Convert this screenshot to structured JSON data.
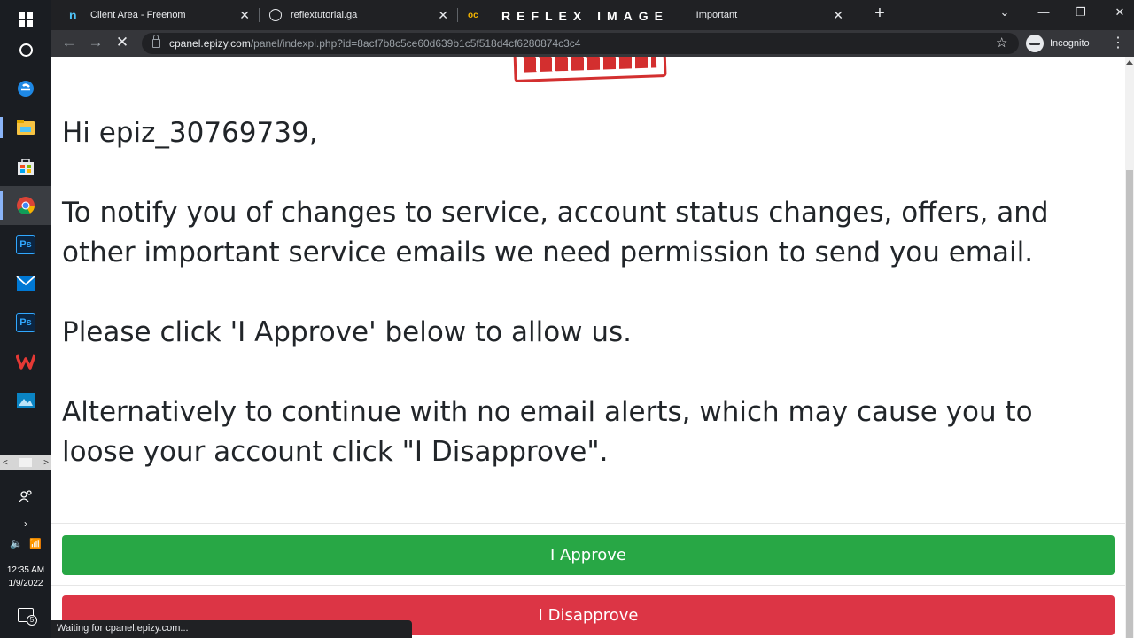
{
  "taskbar": {
    "clock_time": "12:35 AM",
    "clock_date": "1/9/2022",
    "notification_count": "5"
  },
  "tabs": [
    {
      "title": "Client Area - Freenom"
    },
    {
      "title": "reflextutorial.ga"
    },
    {
      "title": "Important"
    }
  ],
  "watermark": "REFLEX IMAGE",
  "address_bar": {
    "host": "cpanel.epizy.com",
    "path": "/panel/indexpl.php?id=8acf7b8c5ce60d639b1c5f518d4cf6280874c3c4"
  },
  "profile": {
    "label": "Incognito"
  },
  "message": {
    "greeting": "Hi epiz_30769739,",
    "body": "To notify you of changes to service, account status changes, offers, and other important service emails we need permission to send you email.",
    "instruction": "Please click 'I Approve' below to allow us.",
    "alternative": "Alternatively to continue with no email alerts, which may cause you to loose your account click \"I Disapprove\"."
  },
  "buttons": {
    "approve": "I Approve",
    "disapprove": "I Disapprove"
  },
  "status_bar": "Waiting for cpanel.epizy.com...",
  "colors": {
    "approve": "#28a745",
    "disapprove": "#dc3545",
    "taskbar": "#1a1d22",
    "chrome_dark": "#202124"
  }
}
